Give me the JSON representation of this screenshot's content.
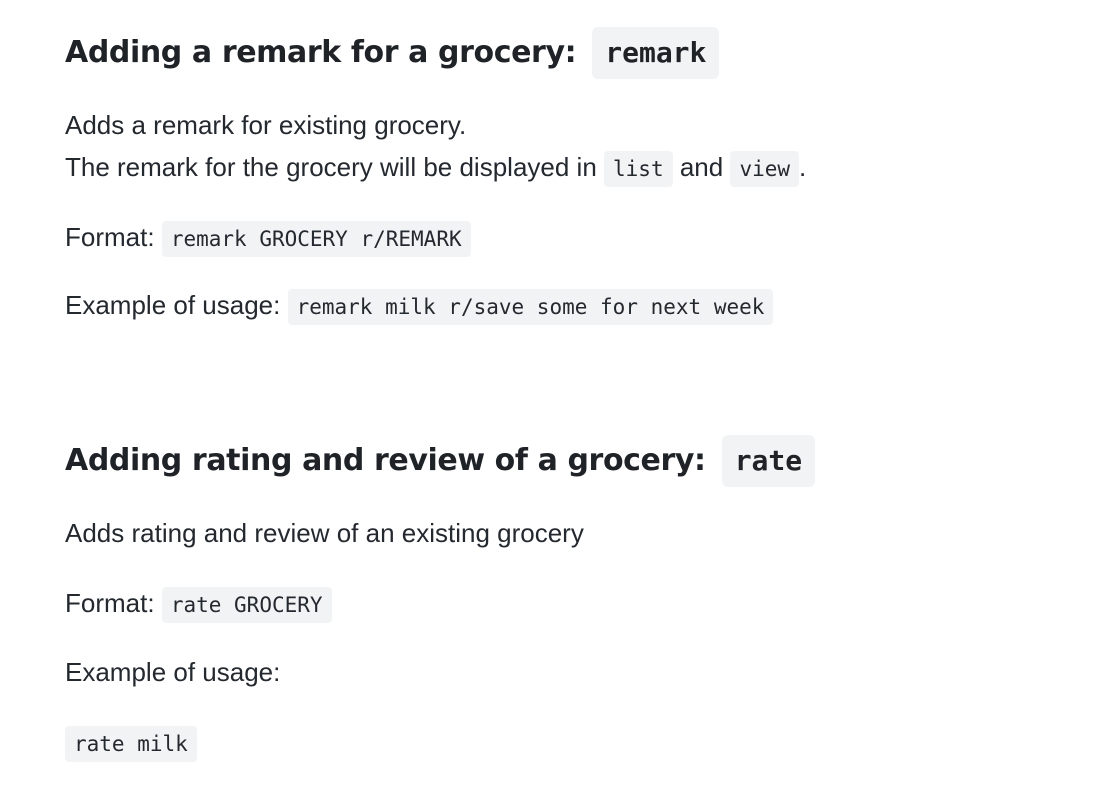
{
  "remark_section": {
    "title": "Adding a remark for a grocery:",
    "command": "remark",
    "desc_line1": "Adds a remark for existing grocery.",
    "desc_line2_pre": "The remark for the grocery will be displayed in",
    "desc_code1": "list",
    "desc_and": "and",
    "desc_code2": "view",
    "desc_end": ".",
    "format_label": "Format:",
    "format_code": "remark GROCERY r/REMARK",
    "example_label": "Example of usage:",
    "example_code": "remark milk r/save some for next week"
  },
  "rate_section": {
    "title": "Adding rating and review of a grocery:",
    "command": "rate",
    "desc": "Adds rating and review of an existing grocery",
    "format_label": "Format:",
    "format_code": "rate GROCERY",
    "example_label": "Example of usage:",
    "example_code": "rate milk"
  }
}
